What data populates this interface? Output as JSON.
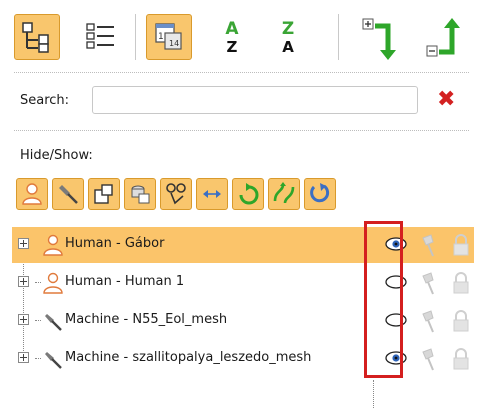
{
  "toolbar": {
    "buttons": [
      {
        "name": "tree-view-button",
        "active": true
      },
      {
        "name": "list-view-button",
        "active": false
      },
      {
        "name": "calendar-button",
        "active": true
      },
      {
        "name": "sort-a-z-button",
        "top": "A",
        "bottom": "Z"
      },
      {
        "name": "sort-z-a-button",
        "top": "Z",
        "bottom": "A"
      },
      {
        "name": "expand-all-button"
      },
      {
        "name": "collapse-all-button"
      }
    ]
  },
  "search": {
    "label": "Search:",
    "value": "",
    "clear_icon": "red-x-icon"
  },
  "hide_show": {
    "label": "Hide/Show:",
    "buttons": [
      "human-icon",
      "hammer-icon",
      "shape-icon",
      "group-icon",
      "waypoint-icon",
      "arrows-icon",
      "rotate-green-icon",
      "swap-icon",
      "rotate-blue-icon"
    ]
  },
  "tree": {
    "rows": [
      {
        "label": "Human - Gábor",
        "type": "human",
        "visible": true,
        "selected": true
      },
      {
        "label": "Human - Human 1",
        "type": "human",
        "visible": false,
        "selected": false
      },
      {
        "label": "Machine - N55_Eol_mesh",
        "type": "machine",
        "visible": false,
        "selected": false
      },
      {
        "label": "Machine - szallitopalya_leszedo_mesh",
        "type": "machine",
        "visible": true,
        "selected": false
      }
    ]
  },
  "colors": {
    "accent": "#f9c66d",
    "selection": "#fbc46a",
    "highlight_box": "#d41f1f"
  }
}
